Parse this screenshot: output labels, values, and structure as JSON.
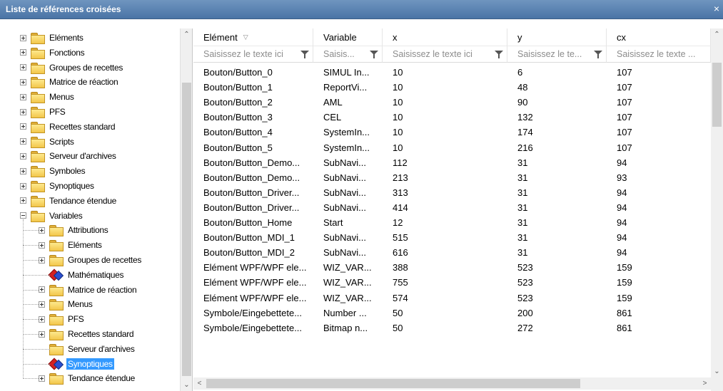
{
  "window": {
    "title": "Liste de références croisées",
    "close_glyph": "×"
  },
  "tree": {
    "items": [
      {
        "label": "Eléments",
        "level": 0,
        "expander": "plus",
        "icon": "folder-icon"
      },
      {
        "label": "Fonctions",
        "level": 0,
        "expander": "plus",
        "icon": "folder-icon"
      },
      {
        "label": "Groupes de recettes",
        "level": 0,
        "expander": "plus",
        "icon": "folder-icon"
      },
      {
        "label": "Matrice de réaction",
        "level": 0,
        "expander": "plus",
        "icon": "folder-icon"
      },
      {
        "label": "Menus",
        "level": 0,
        "expander": "plus",
        "icon": "folder-icon"
      },
      {
        "label": "PFS",
        "level": 0,
        "expander": "plus",
        "icon": "folder-icon"
      },
      {
        "label": "Recettes standard",
        "level": 0,
        "expander": "plus",
        "icon": "folder-icon"
      },
      {
        "label": "Scripts",
        "level": 0,
        "expander": "plus",
        "icon": "folder-icon"
      },
      {
        "label": "Serveur d'archives",
        "level": 0,
        "expander": "plus",
        "icon": "folder-icon"
      },
      {
        "label": "Symboles",
        "level": 0,
        "expander": "plus",
        "icon": "folder-icon"
      },
      {
        "label": "Synoptiques",
        "level": 0,
        "expander": "plus",
        "icon": "folder-icon"
      },
      {
        "label": "Tendance étendue",
        "level": 0,
        "expander": "plus",
        "icon": "folder-icon"
      },
      {
        "label": "Variables",
        "level": 0,
        "expander": "minus",
        "icon": "folder-icon"
      },
      {
        "label": "Attributions",
        "level": 1,
        "expander": "plus",
        "icon": "folder-icon"
      },
      {
        "label": "Eléments",
        "level": 1,
        "expander": "plus",
        "icon": "folder-icon"
      },
      {
        "label": "Groupes de recettes",
        "level": 1,
        "expander": "plus",
        "icon": "folder-icon"
      },
      {
        "label": "Mathématiques",
        "level": 1,
        "expander": "none",
        "icon": "diamond-icon"
      },
      {
        "label": "Matrice de réaction",
        "level": 1,
        "expander": "plus",
        "icon": "folder-icon"
      },
      {
        "label": "Menus",
        "level": 1,
        "expander": "plus",
        "icon": "folder-icon"
      },
      {
        "label": "PFS",
        "level": 1,
        "expander": "plus",
        "icon": "folder-icon"
      },
      {
        "label": "Recettes standard",
        "level": 1,
        "expander": "plus",
        "icon": "folder-icon"
      },
      {
        "label": "Serveur d'archives",
        "level": 1,
        "expander": "none",
        "icon": "folder-icon"
      },
      {
        "label": "Synoptiques",
        "level": 1,
        "expander": "none",
        "icon": "diamond-icon",
        "selected": true
      },
      {
        "label": "Tendance étendue",
        "level": 1,
        "expander": "plus",
        "icon": "folder-icon"
      }
    ]
  },
  "grid": {
    "columns": [
      {
        "key": "element",
        "label": "Elément",
        "sorted": true,
        "filter_placeholder": "Saisissez le texte ici"
      },
      {
        "key": "variable",
        "label": "Variable",
        "sorted": false,
        "filter_placeholder": "Saisis..."
      },
      {
        "key": "x",
        "label": "x",
        "sorted": false,
        "filter_placeholder": "Saisissez le texte ici"
      },
      {
        "key": "y",
        "label": "y",
        "sorted": false,
        "filter_placeholder": "Saisissez le te..."
      },
      {
        "key": "cx",
        "label": "cx",
        "sorted": false,
        "filter_placeholder": "Saisissez le texte ..."
      }
    ],
    "rows": [
      [
        "Bouton/Button_0",
        "SIMUL In...",
        "10",
        "6",
        "107"
      ],
      [
        "Bouton/Button_1",
        "ReportVi...",
        "10",
        "48",
        "107"
      ],
      [
        "Bouton/Button_2",
        "AML",
        "10",
        "90",
        "107"
      ],
      [
        "Bouton/Button_3",
        "CEL",
        "10",
        "132",
        "107"
      ],
      [
        "Bouton/Button_4",
        "SystemIn...",
        "10",
        "174",
        "107"
      ],
      [
        "Bouton/Button_5",
        "SystemIn...",
        "10",
        "216",
        "107"
      ],
      [
        "Bouton/Button_Demo...",
        "SubNavi...",
        "112",
        "31",
        "94"
      ],
      [
        "Bouton/Button_Demo...",
        "SubNavi...",
        "213",
        "31",
        "93"
      ],
      [
        "Bouton/Button_Driver...",
        "SubNavi...",
        "313",
        "31",
        "94"
      ],
      [
        "Bouton/Button_Driver...",
        "SubNavi...",
        "414",
        "31",
        "94"
      ],
      [
        "Bouton/Button_Home",
        "Start",
        "12",
        "31",
        "94"
      ],
      [
        "Bouton/Button_MDI_1",
        "SubNavi...",
        "515",
        "31",
        "94"
      ],
      [
        "Bouton/Button_MDI_2",
        "SubNavi...",
        "616",
        "31",
        "94"
      ],
      [
        "Elément WPF/WPF ele...",
        "WIZ_VAR...",
        "388",
        "523",
        "159"
      ],
      [
        "Elément WPF/WPF ele...",
        "WIZ_VAR...",
        "755",
        "523",
        "159"
      ],
      [
        "Elément WPF/WPF ele...",
        "WIZ_VAR...",
        "574",
        "523",
        "159"
      ],
      [
        "Symbole/Eingebettete...",
        "Number ...",
        "50",
        "200",
        "861"
      ],
      [
        "Symbole/Eingebettete...",
        "Bitmap n...",
        "50",
        "272",
        "861"
      ]
    ]
  },
  "scroll": {
    "up": "⌃",
    "down": "⌄",
    "left": "<",
    "right": ">"
  }
}
